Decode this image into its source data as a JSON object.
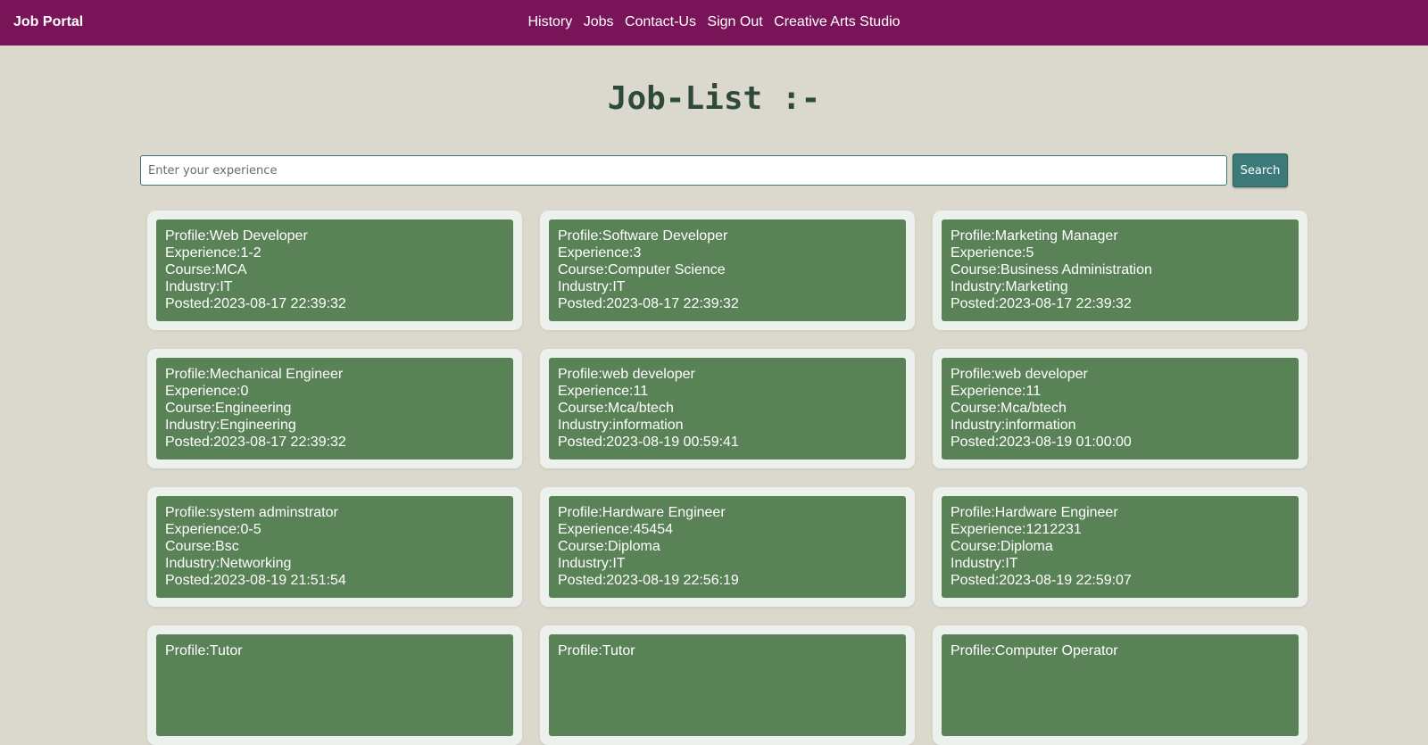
{
  "navbar": {
    "brand": "Job Portal",
    "links": [
      "History",
      "Jobs",
      "Contact-Us",
      "Sign Out",
      "Creative Arts Studio"
    ]
  },
  "page_title": "Job-List :-",
  "search": {
    "placeholder": "Enter your experience",
    "value": "",
    "button_label": "Search"
  },
  "jobs": [
    {
      "profile": "Profile:Web Developer",
      "experience": "Experience:1-2",
      "course": "Course:MCA",
      "industry": "Industry:IT",
      "posted": "Posted:2023-08-17 22:39:32"
    },
    {
      "profile": "Profile:Software Developer",
      "experience": "Experience:3",
      "course": "Course:Computer Science",
      "industry": "Industry:IT",
      "posted": "Posted:2023-08-17 22:39:32"
    },
    {
      "profile": "Profile:Marketing Manager",
      "experience": "Experience:5",
      "course": "Course:Business Administration",
      "industry": "Industry:Marketing",
      "posted": "Posted:2023-08-17 22:39:32"
    },
    {
      "profile": "Profile:Mechanical Engineer",
      "experience": "Experience:0",
      "course": "Course:Engineering",
      "industry": "Industry:Engineering",
      "posted": "Posted:2023-08-17 22:39:32"
    },
    {
      "profile": "Profile:web developer",
      "experience": "Experience:11",
      "course": "Course:Mca/btech",
      "industry": "Industry:information",
      "posted": "Posted:2023-08-19 00:59:41"
    },
    {
      "profile": "Profile:web developer",
      "experience": "Experience:11",
      "course": "Course:Mca/btech",
      "industry": "Industry:information",
      "posted": "Posted:2023-08-19 01:00:00"
    },
    {
      "profile": "Profile:system adminstrator",
      "experience": "Experience:0-5",
      "course": "Course:Bsc",
      "industry": "Industry:Networking",
      "posted": "Posted:2023-08-19 21:51:54"
    },
    {
      "profile": "Profile:Hardware Engineer",
      "experience": "Experience:45454",
      "course": "Course:Diploma",
      "industry": "Industry:IT",
      "posted": "Posted:2023-08-19 22:56:19"
    },
    {
      "profile": "Profile:Hardware Engineer",
      "experience": "Experience:1212231",
      "course": "Course:Diploma",
      "industry": "Industry:IT",
      "posted": "Posted:2023-08-19 22:59:07"
    },
    {
      "profile": "Profile:Tutor"
    },
    {
      "profile": "Profile:Tutor"
    },
    {
      "profile": "Profile:Computer Operator"
    }
  ],
  "colors": {
    "navbar": "#7a1458",
    "background": "#dbd9cd",
    "card_outer": "#edf1ee",
    "card_inner": "#5a8257",
    "search_button": "#3c7a7a",
    "title": "#2f4a3c"
  }
}
